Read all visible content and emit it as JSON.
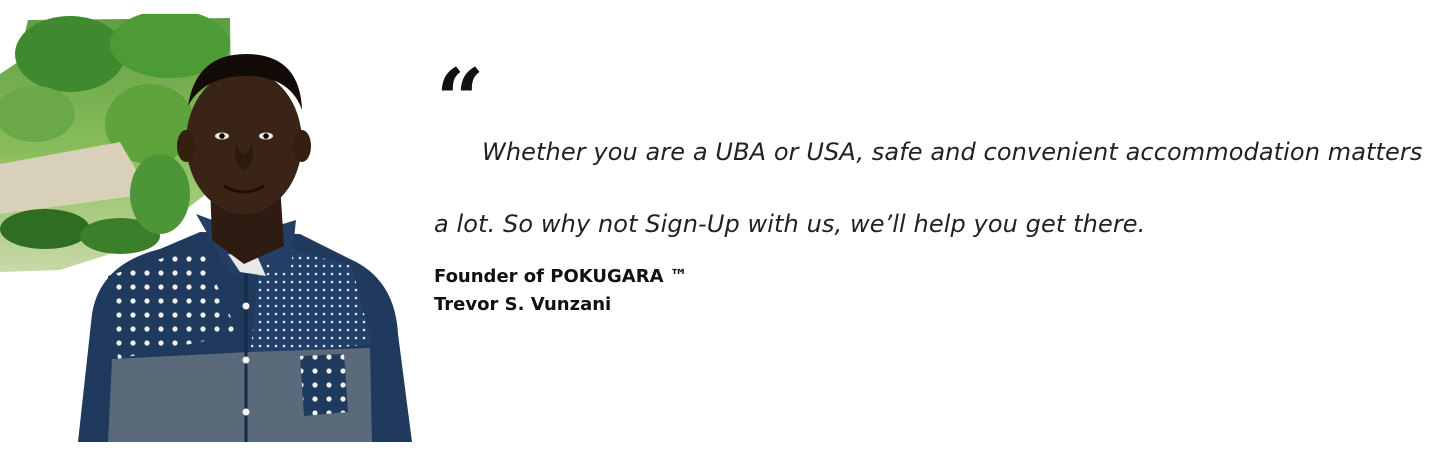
{
  "quote": {
    "mark": "“",
    "text": "Whether you are a UBA or USA, safe and convenient accommodation matters a lot. So why not Sign-Up with us, we’ll help you get there."
  },
  "attribution": {
    "role": "Founder of POKUGARA ™",
    "name": "Trevor S. Vunzani"
  },
  "portrait": {
    "subject": "smiling young man in navy polka-dot shirt",
    "background": "garden with trees and shrubs"
  },
  "colors": {
    "shirt": "#1f3a5c",
    "shirt_panel": "#5b6a7a",
    "skin": "#3a2418",
    "foliage": "#3f8a2e",
    "text": "#111111"
  }
}
